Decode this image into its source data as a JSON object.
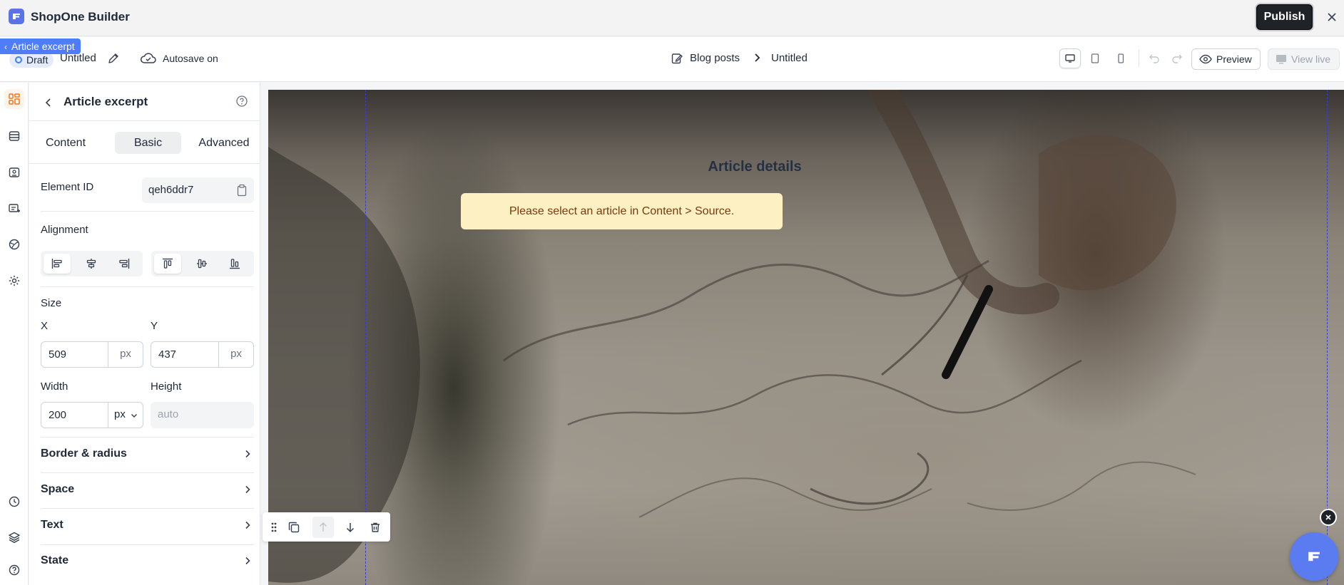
{
  "app": {
    "title": "ShopOne Builder",
    "publish_label": "Publish"
  },
  "toolbar": {
    "selected_element_tag": "Article excerpt",
    "status_badge": "Draft",
    "doc_title": "Untitled",
    "autosave_label": "Autosave on",
    "breadcrumb": {
      "parent": "Blog posts",
      "separator": "›",
      "current": "Untitled"
    },
    "devices": [
      "desktop-icon",
      "tablet-icon",
      "mobile-icon"
    ],
    "preview_label": "Preview",
    "view_live_label": "View live"
  },
  "rail": {
    "items": [
      "elements-icon",
      "sections-icon",
      "pages-icon",
      "content-icon",
      "globe-icon",
      "settings-icon",
      "history-icon",
      "layers-icon",
      "help-icon"
    ]
  },
  "panel": {
    "title": "Article excerpt",
    "tabs": [
      {
        "label": "Content",
        "active": false
      },
      {
        "label": "Basic",
        "active": true
      },
      {
        "label": "Advanced",
        "active": false
      }
    ],
    "element_id_label": "Element ID",
    "element_id_value": "qeh6ddr7",
    "alignment_label": "Alignment",
    "size_label": "Size",
    "x_label": "X",
    "x_value": "509",
    "x_unit": "px",
    "y_label": "Y",
    "y_value": "437",
    "y_unit": "px",
    "width_label": "Width",
    "width_value": "200",
    "width_unit": "px",
    "height_label": "Height",
    "height_value": "auto",
    "sections": [
      "Border & radius",
      "Space",
      "Text",
      "State"
    ]
  },
  "canvas": {
    "heading": "Article details",
    "notice": "Please select an article in Content > Source."
  },
  "colors": {
    "accent": "#4f7cf7",
    "active_rail": "#f97316",
    "notice_bg": "#fdf0c2",
    "notice_text": "#7a3a10"
  }
}
